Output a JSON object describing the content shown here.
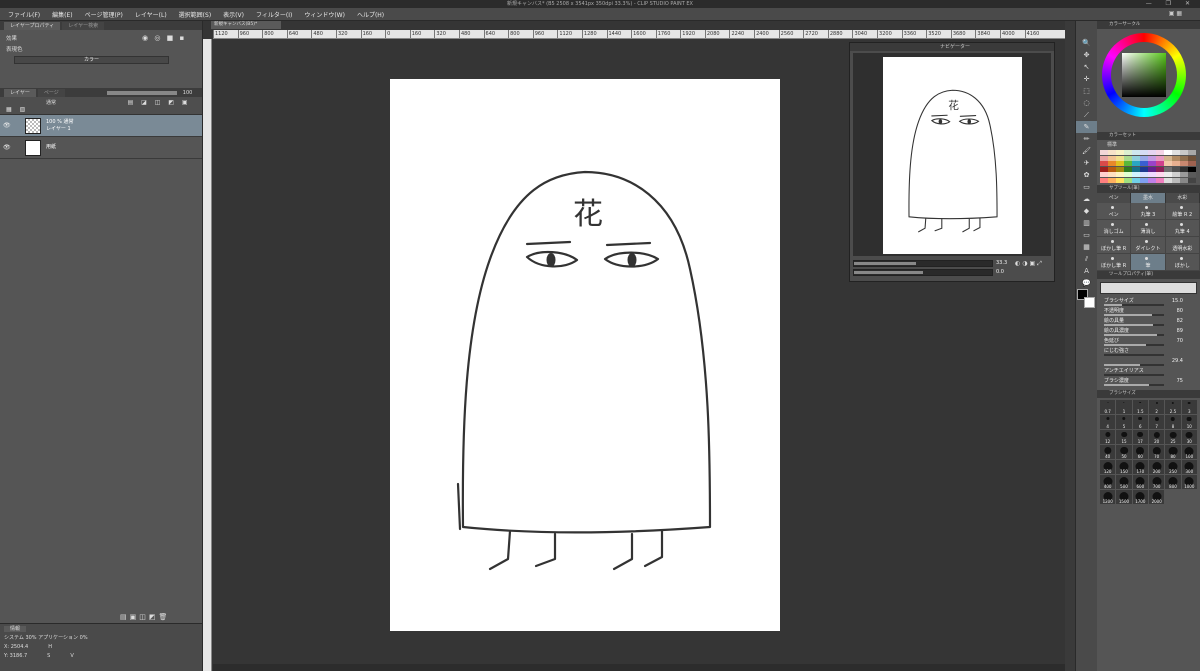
{
  "title": "新規キャンバス* (B5 2508 x 3541px 350dpi 33.3%) - CLIP STUDIO PAINT EX",
  "menu": [
    "ファイル(F)",
    "編集(E)",
    "ページ管理(P)",
    "レイヤー(L)",
    "選択範囲(S)",
    "表示(V)",
    "フィルター(I)",
    "ウィンドウ(W)",
    "ヘルプ(H)"
  ],
  "left_panel": {
    "tabs": [
      "レイヤープロパティ",
      "レイヤー検索"
    ],
    "effect_label": "効果",
    "expression_label": "表現色",
    "expression_value": "カラー",
    "layer_tabs": [
      "レイヤー",
      "ページ"
    ],
    "blend_mode": "通常",
    "opacity": "100",
    "layers": [
      {
        "title": "100 % 通常",
        "name": "レイヤー 1"
      },
      {
        "title": "",
        "name": "用紙"
      }
    ],
    "info_tab": "情報",
    "info_stats": [
      "システム 30%  アプリケーション 0%",
      "X: 2504.4",
      "Y: 3186.7",
      "H",
      "S",
      "V"
    ]
  },
  "canvas": {
    "tab": "新規キャンバス(B5)*",
    "ruler_marks": [
      "1120",
      "960",
      "800",
      "640",
      "480",
      "320",
      "160",
      "0",
      "160",
      "320",
      "480",
      "640",
      "800",
      "960",
      "1120",
      "1280",
      "1440",
      "1600",
      "1760",
      "1920",
      "2080",
      "2240",
      "2400",
      "2560",
      "2720",
      "2880",
      "3040",
      "3200",
      "3360",
      "3520",
      "3680",
      "3840",
      "4000",
      "4160"
    ],
    "drawing_text": "花"
  },
  "navigator": {
    "title": "ナビゲーター",
    "zoom": "33.3",
    "rotate": "0.0"
  },
  "right_panel": {
    "color_tab": "カラーサークル",
    "palette_tab": "カラーセット",
    "palette_name": "標準",
    "subtool_tab": "サブツール[筆]",
    "subtool_groups": [
      "ペン",
      "墨水",
      "水彩"
    ],
    "subtools": [
      "ペン",
      "丸筆 3",
      "絵筆 R 2",
      "消しゴム",
      "薄消し",
      "丸筆 4",
      "ぼかし筆 R",
      "ダイレクト",
      "透明水彩",
      "ぼかし筆 R",
      "筆",
      "ぼかし"
    ],
    "toolprop_tab": "ツールプロパティ[筆]",
    "props": [
      {
        "label": "ブラシサイズ",
        "value": "15.0",
        "pct": 0.3
      },
      {
        "label": "不透明度",
        "value": "80",
        "pct": 0.8
      },
      {
        "label": "絵の具量",
        "value": "82",
        "pct": 0.82
      },
      {
        "label": "絵の具濃度",
        "value": "89",
        "pct": 0.89
      },
      {
        "label": "色延び",
        "value": "70",
        "pct": 0.7
      },
      {
        "label": "にじむ強さ",
        "value": "",
        "pct": 0.0
      },
      {
        "label": "",
        "value": "29.4",
        "pct": 0.6
      },
      {
        "label": "アンチエイリアス",
        "value": "",
        "pct": 0.0
      },
      {
        "label": "ブラシ濃度",
        "value": "75",
        "pct": 0.75
      }
    ],
    "brushsize_tab": "ブラシサイズ",
    "sizes": [
      "0.7",
      "1",
      "1.5",
      "2",
      "2.5",
      "3",
      "4",
      "5",
      "6",
      "7",
      "8",
      "10",
      "12",
      "15",
      "17",
      "20",
      "25",
      "30",
      "40",
      "50",
      "60",
      "70",
      "80",
      "100",
      "120",
      "150",
      "170",
      "200",
      "250",
      "300",
      "400",
      "500",
      "600",
      "700",
      "800",
      "1000",
      "1200",
      "1500",
      "1700",
      "2000"
    ]
  },
  "colors": {
    "accent": "#6d7e8a",
    "selected_layer": "#7a8a96",
    "fg": "#000000",
    "bg": "#ffffff"
  }
}
